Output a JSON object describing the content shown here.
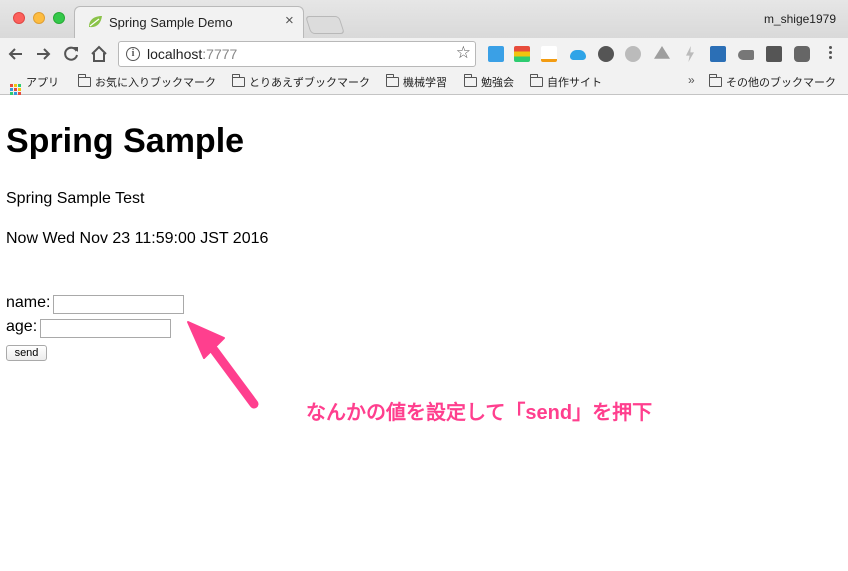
{
  "browser": {
    "tab_title": "Spring Sample Demo",
    "tab_close": "×",
    "profile_name": "m_shige1979",
    "url_host": "localhost",
    "url_port": ":7777",
    "info_symbol": "i",
    "star_symbol": "☆",
    "bookmarks": {
      "apps": "アプリ",
      "items": [
        "お気に入りブックマーク",
        "とりあえずブックマーク",
        "機械学習",
        "勉強会",
        "自作サイト"
      ],
      "overflow_symbol": "»",
      "other": "その他のブックマーク"
    },
    "extension_icons": [
      "b1-icon",
      "layers-icon",
      "amazon-icon",
      "cloud-icon",
      "moon-icon",
      "atom-icon",
      "drive-icon",
      "bolt-icon",
      "s-icon",
      "mouse-icon",
      "jb-icon",
      "pocket-icon"
    ]
  },
  "page": {
    "heading": "Spring Sample",
    "subtitle": "Spring Sample Test",
    "now_text": "Now Wed Nov 23 11:59:00 JST 2016",
    "form": {
      "name_label": "name:",
      "name_value": "",
      "age_label": "age:",
      "age_value": "",
      "send_label": "send"
    }
  },
  "annotation": {
    "text": "なんかの値を設定して「send」を押下",
    "color": "#ff3f8e"
  },
  "colors": {
    "accent_pink": "#ff3f8e",
    "chrome_bg": "#f2f2f2"
  }
}
